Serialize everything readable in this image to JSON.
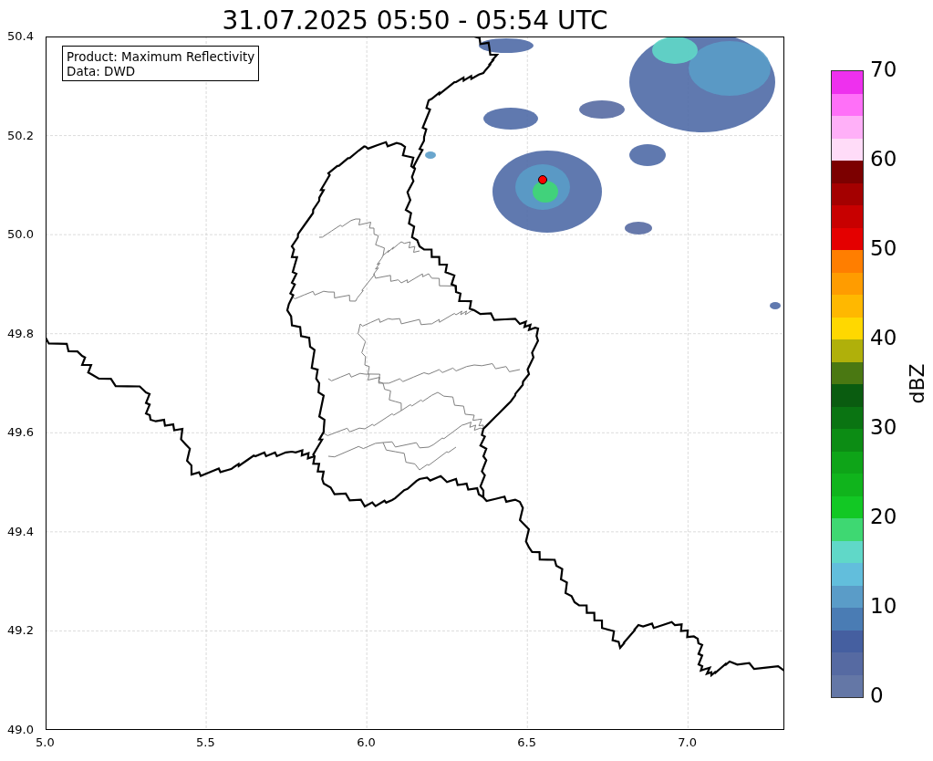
{
  "title": "31.07.2025 05:50 - 05:54 UTC",
  "info_box": {
    "lines": [
      "Product: Maximum Reflectivity",
      "Data: DWD"
    ]
  },
  "axes": {
    "xticks": [
      "5.0",
      "5.5",
      "6.0",
      "6.5",
      "7.0"
    ],
    "yticks": [
      "50.4",
      "50.2",
      "50.0",
      "49.8",
      "49.6",
      "49.4",
      "49.2",
      "49.0"
    ]
  },
  "colorbar": {
    "label": "dBZ",
    "ticks": [
      "70",
      "60",
      "50",
      "40",
      "30",
      "20",
      "10",
      "0"
    ],
    "segments": [
      {
        "color": "#6477a6"
      },
      {
        "color": "#566aa2"
      },
      {
        "color": "#455fa0"
      },
      {
        "color": "#4a7cb4"
      },
      {
        "color": "#5a9cc8"
      },
      {
        "color": "#62bedc"
      },
      {
        "color": "#60d8c8"
      },
      {
        "color": "#3ed872"
      },
      {
        "color": "#12c824"
      },
      {
        "color": "#10b41c"
      },
      {
        "color": "#0ea418"
      },
      {
        "color": "#0c8c14"
      },
      {
        "color": "#0a7412"
      },
      {
        "color": "#0a5c10"
      },
      {
        "color": "#4a7812"
      },
      {
        "color": "#b0b00a"
      },
      {
        "color": "#ffd800"
      },
      {
        "color": "#ffb800"
      },
      {
        "color": "#ff9c00"
      },
      {
        "color": "#ff7e00"
      },
      {
        "color": "#e40000"
      },
      {
        "color": "#c80000"
      },
      {
        "color": "#a40000"
      },
      {
        "color": "#7c0000"
      },
      {
        "color": "#ffdcf8"
      },
      {
        "color": "#ffb0f8"
      },
      {
        "color": "#ff70f8"
      },
      {
        "color": "#ee30ee"
      }
    ]
  }
}
